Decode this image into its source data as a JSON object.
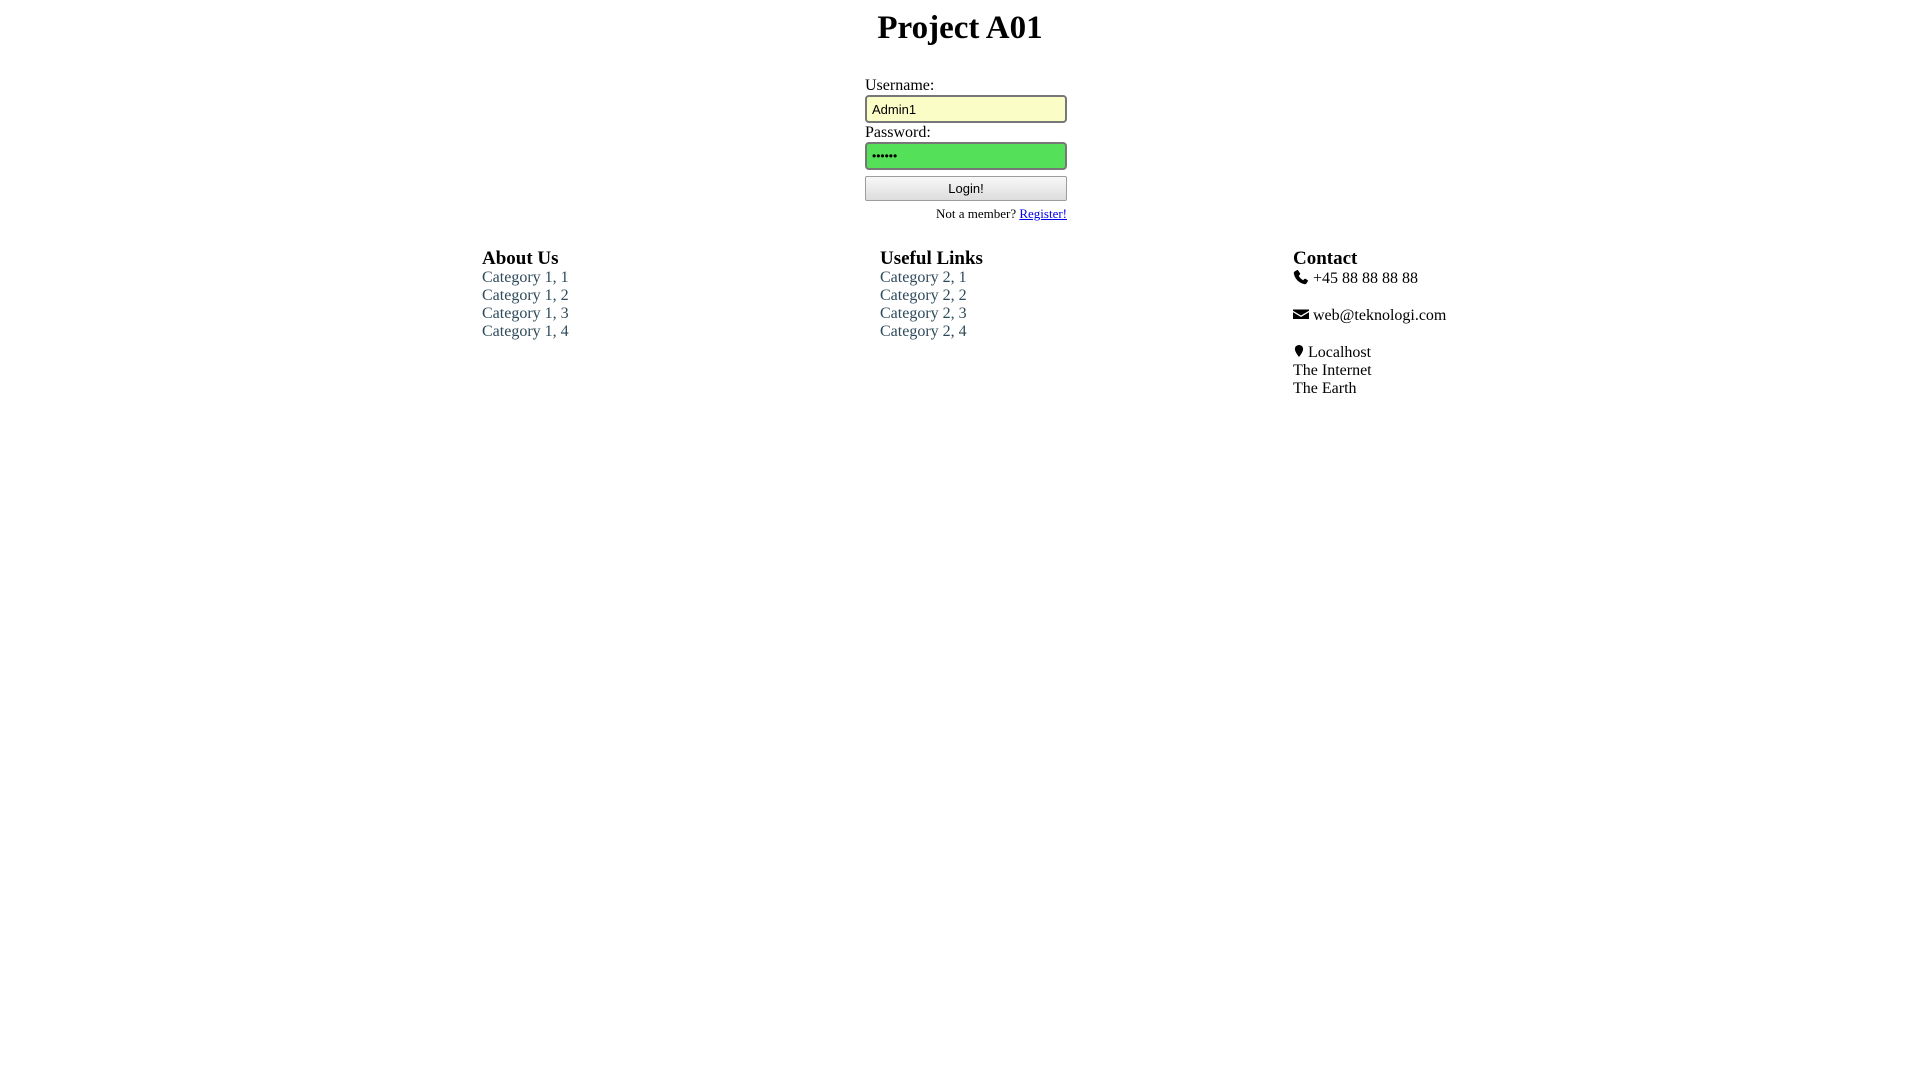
{
  "header": {
    "title": "Project A01"
  },
  "login": {
    "username_label": "Username:",
    "username_value": "Admin1",
    "password_label": "Password:",
    "password_value": "••••••",
    "login_button_label": "Login!",
    "register_prompt": "Not a member?",
    "register_link": "Register!"
  },
  "footer": {
    "about": {
      "heading": "About Us",
      "links": [
        "Category 1, 1",
        "Category 1, 2",
        "Category 1, 3",
        "Category 1, 4"
      ]
    },
    "useful_links": {
      "heading": "Useful Links",
      "links": [
        "Category 2, 1",
        "Category 2, 2",
        "Category 2, 3",
        "Category 2, 4"
      ]
    },
    "contact": {
      "heading": "Contact",
      "phone_icon": "phone-icon",
      "phone": "+45 88 88 88 88",
      "email_icon": "envelope-icon",
      "email": "web@teknologi.com",
      "address_icon": "map-marker-icon",
      "address_line1": "Localhost",
      "address_line2": "The Internet",
      "address_line3": "The Earth"
    }
  },
  "colors": {
    "username_bg": "#fafdc6",
    "password_bg": "#54e058",
    "footer_link": "#2e4a5a",
    "register_link": "#0000ee"
  }
}
